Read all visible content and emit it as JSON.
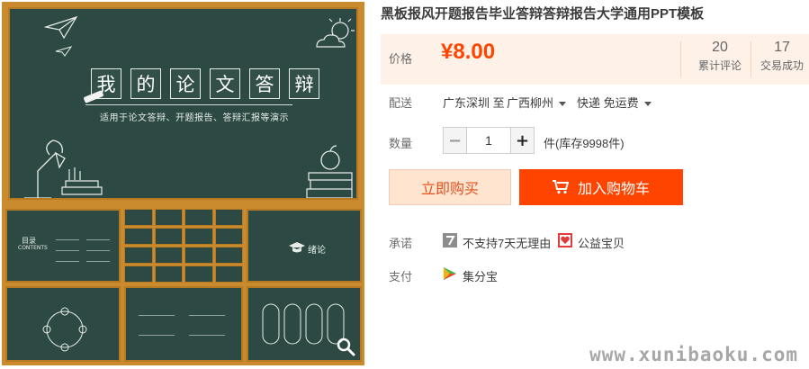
{
  "preview": {
    "main_title_chars": [
      "我",
      "的",
      "论",
      "文",
      "答",
      "辩"
    ],
    "subtitle": "适用于论文答辩、开题报告、答辩汇报等演示",
    "thumb_catalog_label": "目录",
    "thumb_catalog_sub": "CONTENTS",
    "thumb_conclusion_label": "绪论"
  },
  "product": {
    "title": "黑板报风开题报告毕业答辩答辩报告大学通用PPT模板",
    "price_label": "价格",
    "price": "¥8.00",
    "reviews_count": "20",
    "reviews_label": "累计评论",
    "sales_count": "17",
    "sales_label": "交易成功",
    "delivery_label": "配送",
    "delivery_from": "广东深圳 至",
    "delivery_to": "广西柳州",
    "shipping": "快递 免运费",
    "quantity_label": "数量",
    "quantity_value": "1",
    "stock_text": "件(库存9998件)",
    "buy_now": "立即购买",
    "add_to_cart": "加入购物车",
    "promise_label": "承诺",
    "promise_text": "不支持7天无理由",
    "charity_text": "公益宝贝",
    "payment_label": "支付",
    "payment_text": "集分宝"
  },
  "watermark": "www.xunibaoku.com",
  "colors": {
    "accent": "#ff4400",
    "price_bg": "#fef1e8",
    "board": "#2c4a43",
    "frame": "#c98b2e"
  }
}
